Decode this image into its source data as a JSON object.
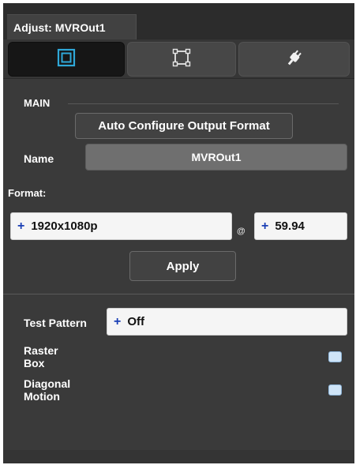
{
  "window": {
    "title": "Adjust: MVROut1"
  },
  "toolbar": {
    "tabs": [
      {
        "icon": "square-frame-icon",
        "active": true
      },
      {
        "icon": "crop-corners-icon",
        "active": false
      },
      {
        "icon": "plug-icon",
        "active": false
      }
    ],
    "active_color": "#2fa8d8"
  },
  "main": {
    "section_label": "MAIN",
    "auto_configure_label": "Auto Configure Output Format",
    "name_label": "Name",
    "name_value": "MVROut1",
    "format_label": "Format:",
    "resolution": {
      "prefix": "+",
      "value": "1920x1080p"
    },
    "at_symbol": "@",
    "frame_rate": {
      "prefix": "+",
      "value": "59.94"
    },
    "apply_label": "Apply"
  },
  "test": {
    "pattern_label": "Test Pattern",
    "pattern_value": {
      "prefix": "+",
      "value": "Off"
    },
    "raster_box_label_line1": "Raster",
    "raster_box_label_line2": "Box",
    "diagonal_motion_label_line1": "Diagonal",
    "diagonal_motion_label_line2": "Motion"
  }
}
